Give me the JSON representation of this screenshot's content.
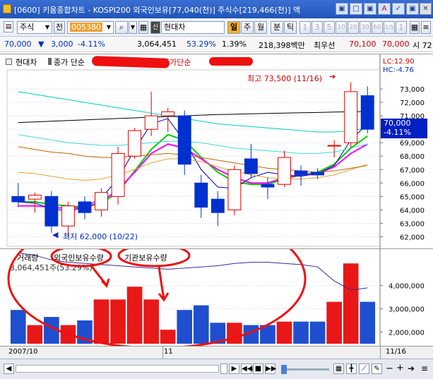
{
  "window": {
    "title": "[0600] 키움종합차트 - KOSPI200 외국인보유[77,040(천)] 주식수[219,466(천)] 액",
    "controls": [
      "▣",
      "□",
      "▣",
      "A",
      "✓",
      "▣",
      "✕"
    ]
  },
  "toolbar": {
    "stock_type": "주식",
    "prev_label": "전",
    "code": "005380",
    "stock_name": "현대차",
    "period_buttons": [
      "일",
      "주",
      "월",
      "분",
      "틱"
    ],
    "minute_buttons": [
      "1",
      "3",
      "5",
      "10",
      "20",
      "30",
      "60",
      "1/5",
      "1"
    ]
  },
  "info": {
    "price": "70,000",
    "change_arrow": "▼",
    "change": "3,000",
    "change_pct": "-4.11%",
    "volume": "3,064,451",
    "vol_pct": "53.29%",
    "pct2": "1.39%",
    "amount": "218,398백만",
    "best_label": "최우선",
    "ask": "70,100",
    "bid": "70,000",
    "extra": "시 72"
  },
  "price_panel": {
    "legend_name": "현대차",
    "legend_ma": "종가 단순",
    "legend_ma2": "종가단순",
    "lc_label": "LC:12.90",
    "hc_label": "HC:-4.76",
    "current_price_tag": "70,000",
    "current_change_tag": "-4.11%",
    "high_label": "최고 73,500 (11/16)",
    "low_label": "최저 62,000 (10/22)",
    "ticks": [
      "73,000",
      "72,000",
      "71,000",
      "70,000",
      "69,000",
      "68,000",
      "67,000",
      "66,000",
      "65,000",
      "64,000",
      "63,000",
      "62,000"
    ]
  },
  "vol_panel": {
    "legend_1": "거래량",
    "legend_2": "외국인보유수량",
    "legend_3": "기관보유수량",
    "value_label": "3,064,451주(53.29%)",
    "ticks": [
      "4,000,000",
      "3,000,000",
      "2,000,000"
    ]
  },
  "dates": {
    "left": "2007/10",
    "mid": "11",
    "right": "11/16"
  },
  "chart_data": {
    "type": "candlestick",
    "title": "현대차",
    "ylim": [
      61.5,
      74
    ],
    "ylim_volume": [
      1.5,
      5.2
    ],
    "candles": [
      {
        "o": 65.0,
        "h": 66.0,
        "l": 64.2,
        "c": 64.6,
        "v": 2.95
      },
      {
        "o": 64.8,
        "h": 65.3,
        "l": 63.8,
        "c": 65.1,
        "v": 2.3
      },
      {
        "o": 65.0,
        "h": 65.4,
        "l": 62.3,
        "c": 62.8,
        "v": 2.65
      },
      {
        "o": 62.8,
        "h": 64.6,
        "l": 62.0,
        "c": 64.3,
        "v": 2.3
      },
      {
        "o": 64.6,
        "h": 65.0,
        "l": 63.3,
        "c": 63.8,
        "v": 2.5
      },
      {
        "o": 64.0,
        "h": 65.6,
        "l": 63.5,
        "c": 65.3,
        "v": 3.4
      },
      {
        "o": 65.0,
        "h": 68.7,
        "l": 64.4,
        "c": 68.2,
        "v": 3.4
      },
      {
        "o": 68.0,
        "h": 70.1,
        "l": 67.8,
        "c": 69.9,
        "v": 3.95
      },
      {
        "o": 70.0,
        "h": 72.8,
        "l": 69.5,
        "c": 71.0,
        "v": 3.4
      },
      {
        "o": 71.0,
        "h": 71.6,
        "l": 69.8,
        "c": 71.3,
        "v": 2.1
      },
      {
        "o": 71.0,
        "h": 71.4,
        "l": 66.6,
        "c": 67.4,
        "v": 2.95
      },
      {
        "o": 66.0,
        "h": 66.6,
        "l": 63.4,
        "c": 64.2,
        "v": 3.15
      },
      {
        "o": 64.8,
        "h": 65.4,
        "l": 62.8,
        "c": 63.8,
        "v": 2.4
      },
      {
        "o": 64.0,
        "h": 67.3,
        "l": 63.6,
        "c": 67.0,
        "v": 2.4
      },
      {
        "o": 67.8,
        "h": 68.9,
        "l": 66.4,
        "c": 66.7,
        "v": 2.3
      },
      {
        "o": 65.9,
        "h": 66.4,
        "l": 64.8,
        "c": 65.7,
        "v": 2.3
      },
      {
        "o": 65.9,
        "h": 68.4,
        "l": 65.7,
        "c": 67.9,
        "v": 2.45
      },
      {
        "o": 66.9,
        "h": 67.3,
        "l": 65.8,
        "c": 66.6,
        "v": 2.45
      },
      {
        "o": 66.8,
        "h": 67.1,
        "l": 66.3,
        "c": 66.6,
        "v": 2.45
      },
      {
        "o": 68.8,
        "h": 69.2,
        "l": 67.9,
        "c": 68.8,
        "v": 3.3
      },
      {
        "o": 69.0,
        "h": 73.5,
        "l": 68.6,
        "c": 72.8,
        "v": 4.95
      },
      {
        "o": 72.5,
        "h": 73.2,
        "l": 69.7,
        "c": 70.0,
        "v": 3.3
      }
    ],
    "ma_series": [
      {
        "color": "#00cc00",
        "values": [
          64.6,
          64.6,
          64.4,
          64.3,
          64.2,
          64.5,
          65.3,
          66.9,
          68.5,
          69.6,
          69.2,
          67.9,
          66.8,
          66.1,
          65.9,
          65.9,
          66.3,
          66.6,
          66.8,
          67.4,
          68.6,
          69.5
        ]
      },
      {
        "color": "#ff00ff",
        "values": [
          64.3,
          64.3,
          64.2,
          64.1,
          64.2,
          64.6,
          65.5,
          66.8,
          68.2,
          68.9,
          68.6,
          67.8,
          67.0,
          66.4,
          66.0,
          66.0,
          66.4,
          66.6,
          66.7,
          67.2,
          68.2,
          68.9
        ]
      },
      {
        "color": "#0000aa",
        "values": [
          64.6,
          64.5,
          64.1,
          63.9,
          64.2,
          64.9,
          66.3,
          68.5,
          70.4,
          70.8,
          69.1,
          67.0,
          65.7,
          65.6,
          66.4,
          66.8,
          66.6,
          66.5,
          66.7,
          67.3,
          69.2,
          70.4
        ]
      },
      {
        "color": "#e8a030",
        "values": [
          66.8,
          66.7,
          66.5,
          66.3,
          66.2,
          66.3,
          66.6,
          67.0,
          67.5,
          67.8,
          67.8,
          67.6,
          67.2,
          66.9,
          66.6,
          66.4,
          66.3,
          66.3,
          66.4,
          66.6,
          67.0,
          67.4
        ]
      },
      {
        "color": "#bb6600",
        "values": [
          68.7,
          68.5,
          68.3,
          68.2,
          68.0,
          67.9,
          67.9,
          68.0,
          68.1,
          68.2,
          68.1,
          67.9,
          67.7,
          67.5,
          67.3,
          67.1,
          67.0,
          66.9,
          66.8,
          66.9,
          67.1,
          67.3
        ]
      },
      {
        "color": "#00c8c8",
        "values": [
          72.8,
          72.6,
          72.4,
          72.2,
          72.0,
          71.8,
          71.6,
          71.4,
          71.2,
          71.0,
          70.8,
          70.6,
          70.4,
          70.3,
          70.2,
          70.1,
          70.0,
          69.9,
          69.8,
          69.8,
          69.9,
          70.1
        ]
      },
      {
        "color": "#40d8d8",
        "values": [
          69.6,
          69.4,
          69.2,
          69.0,
          68.9,
          68.8,
          68.8,
          68.9,
          69.0,
          69.1,
          69.1,
          69.0,
          68.8,
          68.6,
          68.5,
          68.4,
          68.3,
          68.2,
          68.2,
          68.3,
          68.6,
          68.9
        ]
      },
      {
        "color": "#000000",
        "values": [
          70.5,
          70.55,
          70.6,
          70.65,
          70.7,
          70.75,
          70.8,
          70.85,
          70.9,
          70.95,
          71.0,
          71.05,
          71.1,
          71.12,
          71.15,
          71.18,
          71.2,
          71.23,
          71.25,
          71.28,
          71.3,
          71.32
        ]
      }
    ],
    "foreign_holding_line": [
      5.4,
      5.3,
      5.1,
      5.0,
      4.95,
      4.9,
      4.85,
      4.8,
      4.75,
      4.7,
      4.75,
      4.8,
      4.85,
      4.95,
      5.0,
      5.0,
      4.95,
      4.9,
      4.8,
      4.2,
      3.8,
      3.9
    ]
  }
}
